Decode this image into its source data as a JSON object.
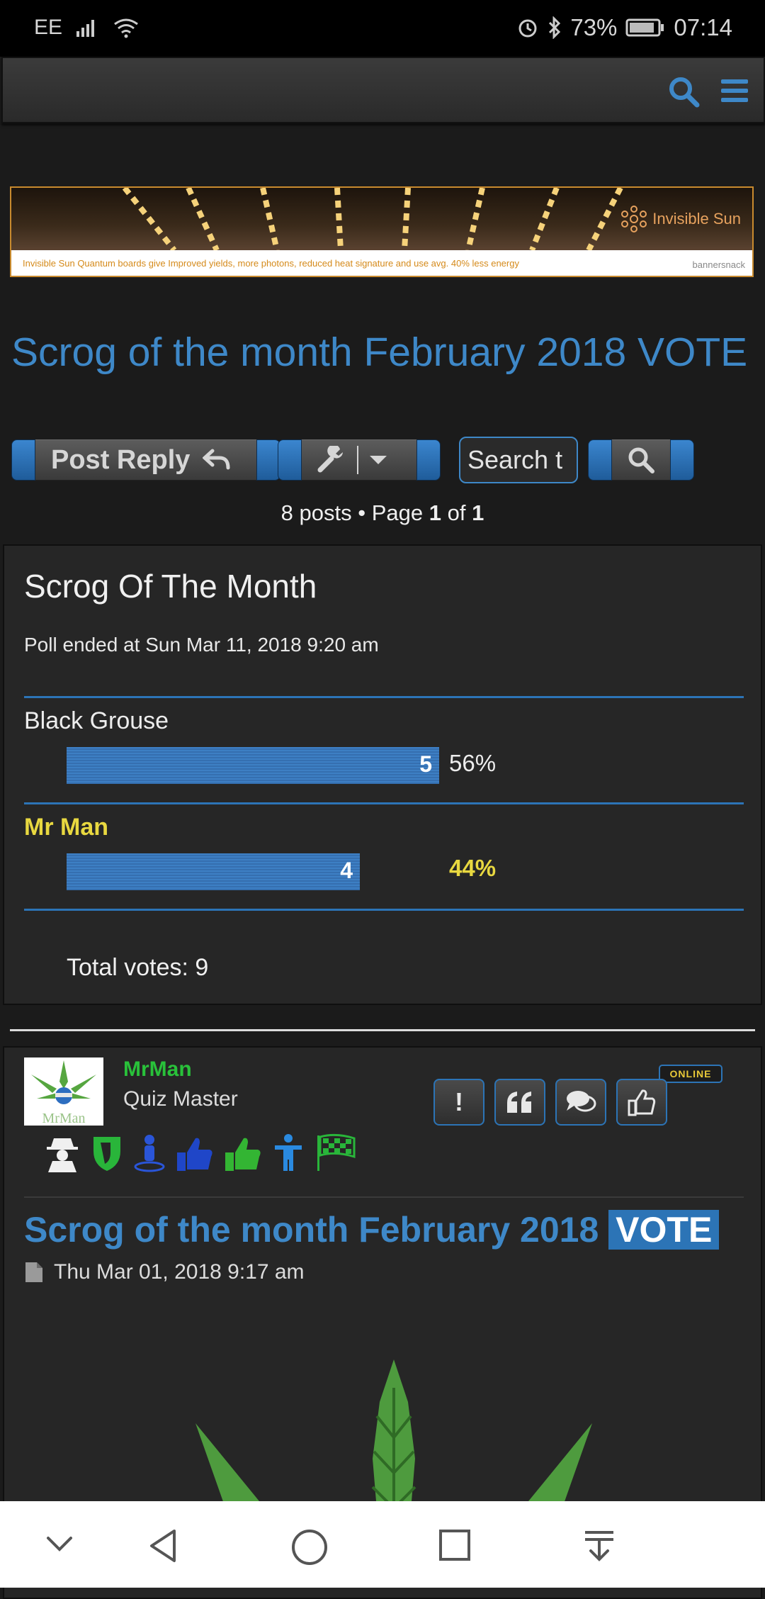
{
  "status_bar": {
    "carrier": "EE",
    "battery": "73%",
    "time": "07:14"
  },
  "navbar": {
    "search_icon": "search-icon",
    "menu_icon": "hamburger-menu-icon"
  },
  "banner": {
    "brand": "Invisible Sun",
    "tagline": "Invisible Sun Quantum boards give Improved yields, more photons, reduced heat signature and use avg. 40% less energy",
    "provider": "bannersnack"
  },
  "topic": {
    "title": "Scrog of the month February 2018 VOTE"
  },
  "actions": {
    "post_reply": "Post Reply",
    "search_placeholder": "Search t"
  },
  "pagination": {
    "prefix": "8 posts • Page ",
    "current": "1",
    "of": " of ",
    "total": "1"
  },
  "poll": {
    "title": "Scrog Of The Month",
    "ended": "Poll ended at Sun Mar 11, 2018 9:20 am",
    "options": [
      {
        "label": "Black Grouse",
        "votes": "5",
        "percent": "56%",
        "share": 0.56,
        "voted": false
      },
      {
        "label": "Mr Man",
        "votes": "4",
        "percent": "44%",
        "share": 0.44,
        "voted": true
      }
    ],
    "total": "Total votes: 9"
  },
  "post": {
    "username": "MrMan",
    "rank": "Quiz Master",
    "avatar_text": "MrMan",
    "online": "ONLINE",
    "buttons": [
      "report-button",
      "quote-button",
      "pm-button",
      "like-button"
    ],
    "title_main": "Scrog of the month February 2018 ",
    "title_highlight": "VOTE",
    "date": "Thu Mar 01, 2018 9:17 am",
    "colors": {
      "username": "#29c13a",
      "link": "#3e88c8",
      "highlight": "#2c74b6"
    }
  }
}
